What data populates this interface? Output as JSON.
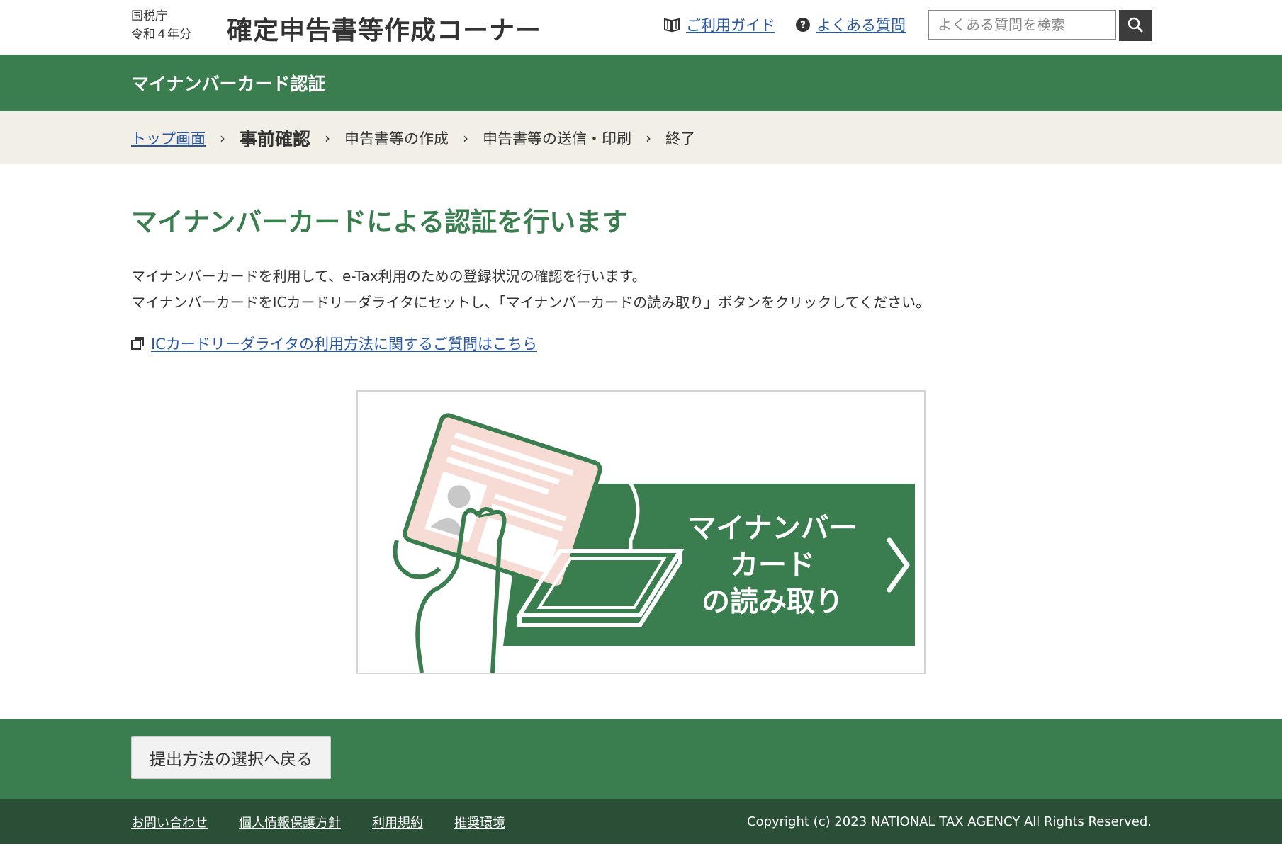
{
  "header": {
    "agency": "国税庁",
    "year": "令和４年分",
    "app_title": "確定申告書等作成コーナー",
    "guide_link": "ご利用ガイド",
    "faq_link": "よくある質問",
    "search_placeholder": "よくある質問を検索"
  },
  "band": {
    "title": "マイナンバーカード認証"
  },
  "breadcrumb": {
    "items": [
      "トップ画面",
      "事前確認",
      "申告書等の作成",
      "申告書等の送信・印刷",
      "終了"
    ],
    "separator": "›"
  },
  "main": {
    "title": "マイナンバーカードによる認証を行います",
    "desc_line1": "マイナンバーカードを利用して、e-Tax利用のための登録状況の確認を行います。",
    "desc_line2": "マイナンバーカードをICカードリーダライタにセットし、「マイナンバーカードの読み取り」ボタンをクリックしてください。",
    "help_link": "ICカードリーダライタの利用方法に関するご質問はこちら",
    "read_button": {
      "line1": "マイナンバー",
      "line2": "カード",
      "line3": "の読み取り"
    }
  },
  "actions": {
    "back_button": "提出方法の選択へ戻る"
  },
  "footer": {
    "links": [
      "お問い合わせ",
      "個人情報保護方針",
      "利用規約",
      "推奨環境"
    ],
    "copyright": "Copyright (c) 2023 NATIONAL TAX AGENCY All Rights Reserved."
  },
  "colors": {
    "brand_green": "#3a7d4e",
    "footer_green": "#2b4f36",
    "breadcrumb_bg": "#f1efe6",
    "link": "#2a58a6",
    "card_pink": "#f7dcd6"
  }
}
